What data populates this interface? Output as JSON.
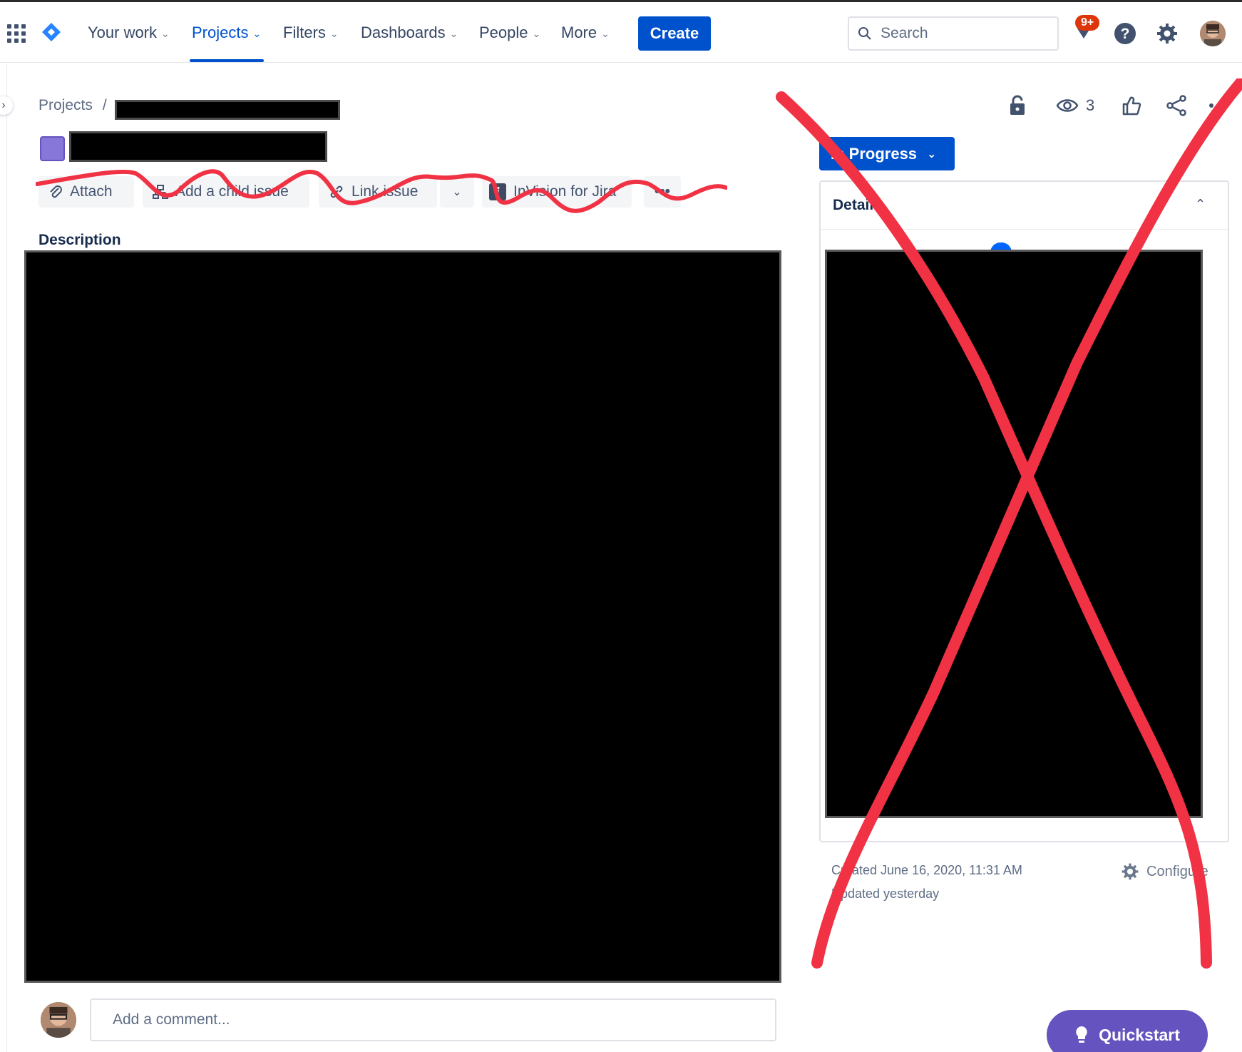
{
  "nav": {
    "items": [
      {
        "label": "Your work"
      },
      {
        "label": "Projects"
      },
      {
        "label": "Filters"
      },
      {
        "label": "Dashboards"
      },
      {
        "label": "People"
      },
      {
        "label": "More"
      }
    ],
    "active_item": "Projects",
    "create_label": "Create",
    "search_placeholder": "Search",
    "notifications_badge": "9+"
  },
  "breadcrumb": {
    "root": "Projects",
    "separator": "/"
  },
  "actions": {
    "attach": "Attach",
    "add_child": "Add a child issue",
    "link": "Link issue",
    "invision": "InVision for Jira",
    "more": "•••"
  },
  "description": {
    "label": "Description"
  },
  "comment": {
    "placeholder": "Add a comment..."
  },
  "issue_header": {
    "watchers_count": "3"
  },
  "status": {
    "label": "In Progress"
  },
  "details": {
    "title": "Details",
    "created": "Created June 16, 2020, 11:31 AM",
    "updated": "Updated yesterday",
    "configure": "Configure"
  },
  "quickstart": {
    "label": "Quickstart"
  },
  "colors": {
    "brand_blue": "#0052cc",
    "quickstart_purple": "#6554c0",
    "annotation_red": "#f03244",
    "project_avatar": "#8777d9"
  }
}
